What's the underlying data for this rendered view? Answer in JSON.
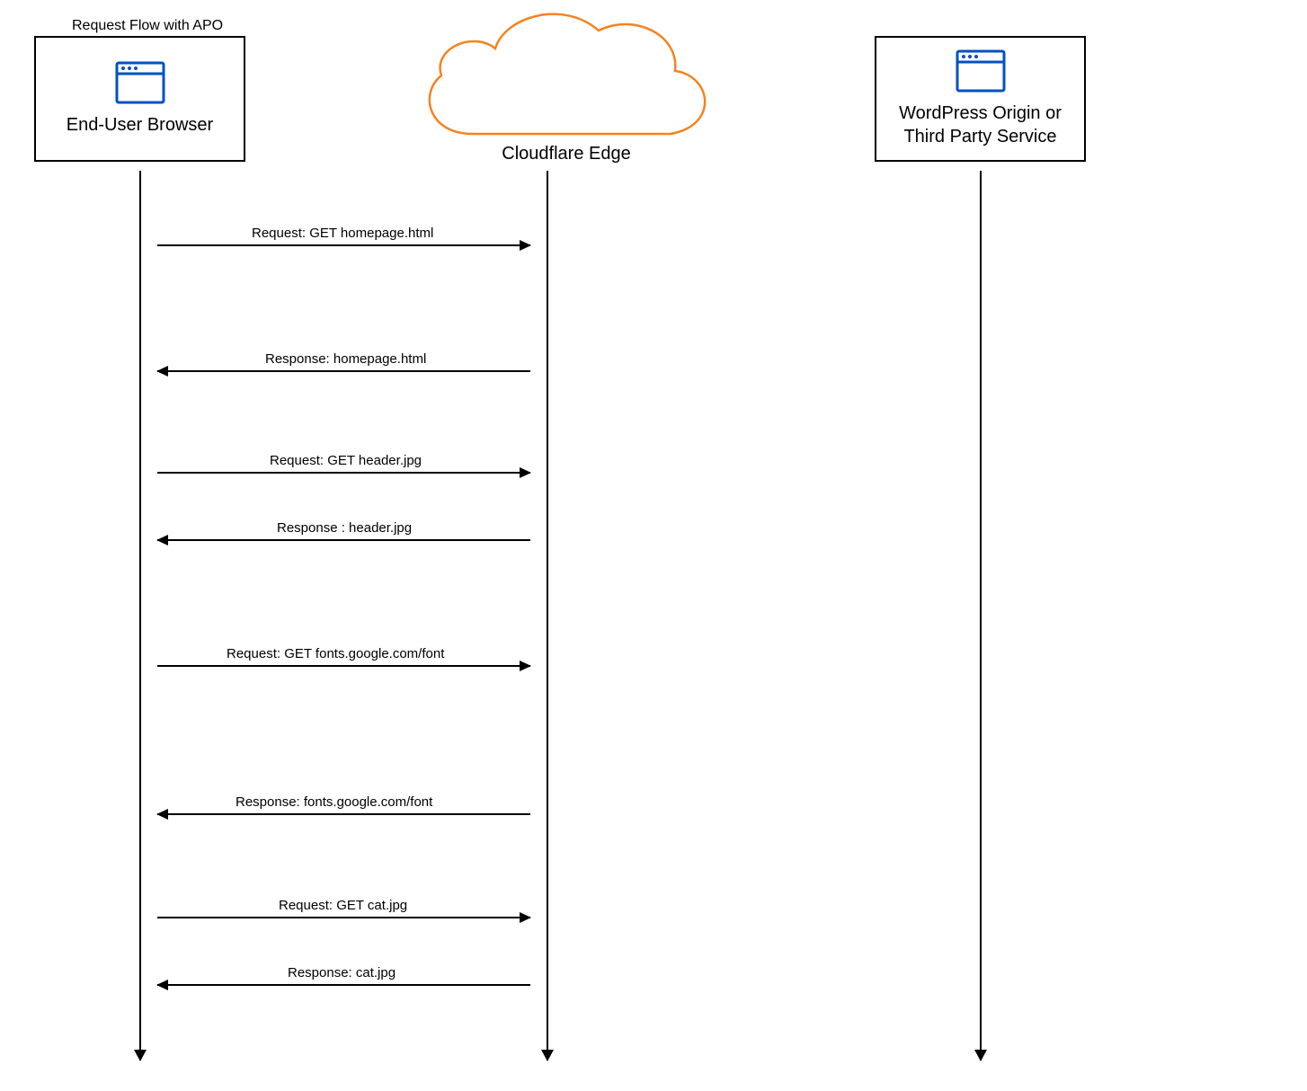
{
  "title": "Request Flow with APO",
  "participants": {
    "browser": {
      "label": "End-User Browser"
    },
    "edge": {
      "label": "Cloudflare Edge"
    },
    "origin": {
      "label": "WordPress Origin or\nThird Party Service",
      "label_line1": "WordPress Origin or",
      "label_line2": "Third Party Service"
    }
  },
  "messages": [
    {
      "label": "Request: GET homepage.html",
      "direction": "right"
    },
    {
      "label": "Response: homepage.html",
      "direction": "left"
    },
    {
      "label": "Request: GET header.jpg",
      "direction": "right"
    },
    {
      "label": "Response : header.jpg",
      "direction": "left"
    },
    {
      "label": "Request: GET fonts.google.com/font",
      "direction": "right"
    },
    {
      "label": "Response: fonts.google.com/font",
      "direction": "left"
    },
    {
      "label": "Request: GET cat.jpg",
      "direction": "right"
    },
    {
      "label": "Response: cat.jpg",
      "direction": "left"
    }
  ],
  "colors": {
    "cloudflare_orange": "#f6821f",
    "browser_blue": "#0051c3",
    "black": "#000000"
  },
  "chart_data": {
    "type": "sequence-diagram",
    "title": "Request Flow with APO",
    "participants": [
      "End-User Browser",
      "Cloudflare Edge",
      "WordPress Origin or Third Party Service"
    ],
    "interactions": [
      {
        "from": "End-User Browser",
        "to": "Cloudflare Edge",
        "label": "Request: GET homepage.html"
      },
      {
        "from": "Cloudflare Edge",
        "to": "End-User Browser",
        "label": "Response: homepage.html"
      },
      {
        "from": "End-User Browser",
        "to": "Cloudflare Edge",
        "label": "Request: GET header.jpg"
      },
      {
        "from": "Cloudflare Edge",
        "to": "End-User Browser",
        "label": "Response : header.jpg"
      },
      {
        "from": "End-User Browser",
        "to": "Cloudflare Edge",
        "label": "Request: GET fonts.google.com/font"
      },
      {
        "from": "Cloudflare Edge",
        "to": "End-User Browser",
        "label": "Response: fonts.google.com/font"
      },
      {
        "from": "End-User Browser",
        "to": "Cloudflare Edge",
        "label": "Request: GET cat.jpg"
      },
      {
        "from": "Cloudflare Edge",
        "to": "End-User Browser",
        "label": "Response: cat.jpg"
      }
    ]
  }
}
